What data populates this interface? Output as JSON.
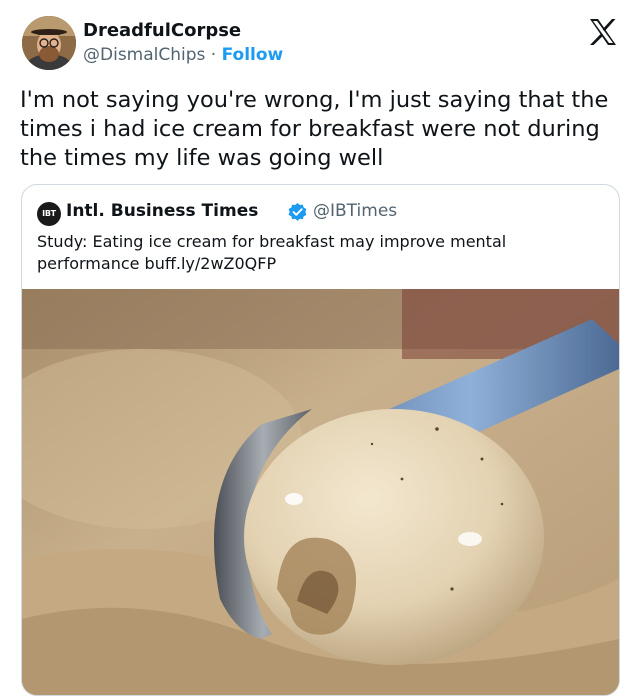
{
  "author": {
    "display_name": "DreadfulCorpse",
    "handle": "@DismalChips",
    "separator": " · ",
    "follow_label": "Follow"
  },
  "tweet": {
    "text": "I'm not saying you're wrong, I'm just saying that the times i had ice cream for breakfast were not during the times my life was going well"
  },
  "quoted_tweet": {
    "avatar_text": "IBT",
    "display_name": "Intl. Business Times",
    "handle": "@IBTimes",
    "text": "Study: Eating ice cream for breakfast may improve mental performance buff.ly/2wZ0QFP"
  },
  "icons": {
    "platform_logo": "x-logo-icon",
    "verified": "verified-badge-icon"
  },
  "colors": {
    "text": "#0f1419",
    "secondary": "#536471",
    "link": "#1d9bf0",
    "border": "#cfd9de"
  }
}
